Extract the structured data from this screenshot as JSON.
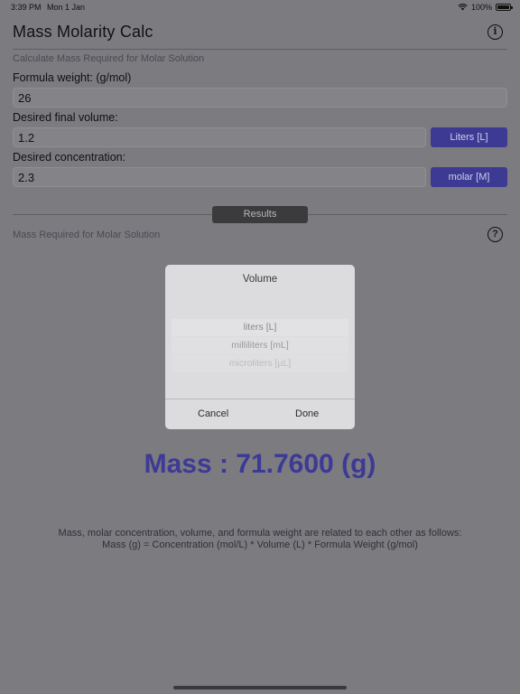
{
  "status": {
    "time": "3:39 PM",
    "date": "Mon 1 Jan",
    "battery": "100%"
  },
  "app": {
    "title": "Mass Molarity Calc"
  },
  "form": {
    "caption": "Calculate Mass Required for Molar Solution",
    "formula_weight_label": "Formula weight:  (g/mol)",
    "formula_weight_value": "26",
    "volume_label": "Desired final volume:",
    "volume_value": "1.2",
    "volume_unit": "Liters [L]",
    "concentration_label": "Desired concentration:",
    "concentration_value": "2.3",
    "concentration_unit": "molar [M]"
  },
  "results": {
    "tab_label": "Results",
    "caption": "Mass Required for Molar Solution",
    "mass_text": "Mass : 71.7600 (g)",
    "explanation_line1": "Mass, molar concentration, volume, and formula weight are related to each other as follows:",
    "explanation_line2": "Mass (g) = Concentration (mol/L) * Volume (L) * Formula Weight (g/mol)"
  },
  "picker": {
    "title": "Volume",
    "options": [
      "liters [L]",
      "milliliters [mL]",
      "microliters [µL]"
    ],
    "cancel_label": "Cancel",
    "done_label": "Done"
  },
  "icons": {
    "wifi": "wifi-icon",
    "battery": "battery-icon",
    "info": "info-icon",
    "help": "help-icon"
  },
  "colors": {
    "accent": "#3d3a94",
    "mass_text": "#3c3a96",
    "overlay_background": "#7b7b80"
  }
}
